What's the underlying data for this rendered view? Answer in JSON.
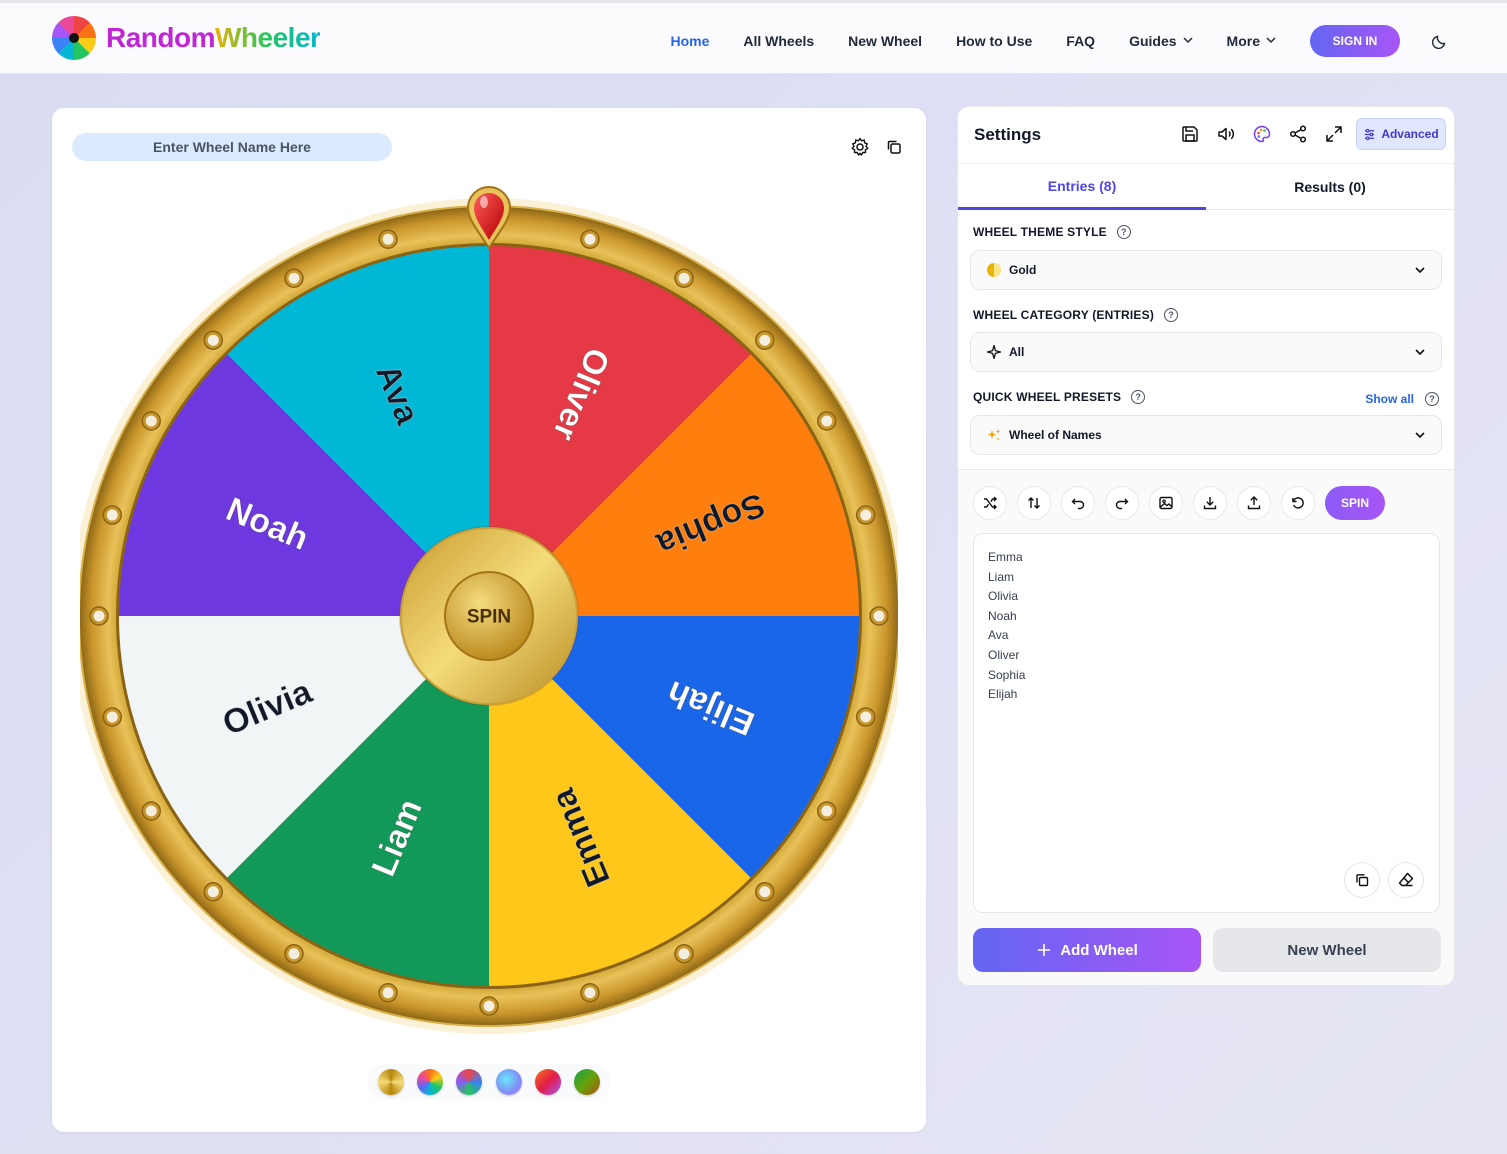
{
  "brand": {
    "part1": "Random",
    "part2": "Wheeler"
  },
  "nav": {
    "home": "Home",
    "all_wheels": "All Wheels",
    "new_wheel": "New Wheel",
    "how_to_use": "How to Use",
    "faq": "FAQ",
    "guides": "Guides",
    "more": "More",
    "sign_in": "SIGN IN"
  },
  "wheel": {
    "name_placeholder": "Enter Wheel Name Here",
    "center_label": "SPIN",
    "segments": [
      {
        "label": "Oliver",
        "color": "#E63946"
      },
      {
        "label": "Sophia",
        "color": "#FF7F0E"
      },
      {
        "label": "Elijah",
        "color": "#1A66E8"
      },
      {
        "label": "Emma",
        "color": "#FFC71A"
      },
      {
        "label": "Liam",
        "color": "#12995A"
      },
      {
        "label": "Olivia",
        "color": "#F1F5F6"
      },
      {
        "label": "Noah",
        "color": "#6E38E0"
      },
      {
        "label": "Ava",
        "color": "#00B7D6"
      }
    ]
  },
  "theme_swatches": [
    "gold-swatch",
    "rainbow-swatch",
    "vivid-swatch",
    "pastel-swatch",
    "sunset-swatch",
    "forest-swatch"
  ],
  "settings": {
    "title": "Settings",
    "advanced": "Advanced",
    "tabs": {
      "entries": "Entries (8)",
      "results": "Results (0)"
    },
    "theme_style_label": "WHEEL THEME STYLE",
    "theme_style_value": "Gold",
    "category_label": "WHEEL CATEGORY (ENTRIES)",
    "category_value": "All",
    "presets_label": "QUICK WHEEL PRESETS",
    "show_all": "Show all",
    "presets_value": "Wheel of Names",
    "spin": "SPIN",
    "entries": [
      "Emma",
      "Liam",
      "Olivia",
      "Noah",
      "Ava",
      "Oliver",
      "Sophia",
      "Elijah"
    ],
    "add_wheel": "Add Wheel",
    "new_wheel": "New Wheel"
  }
}
